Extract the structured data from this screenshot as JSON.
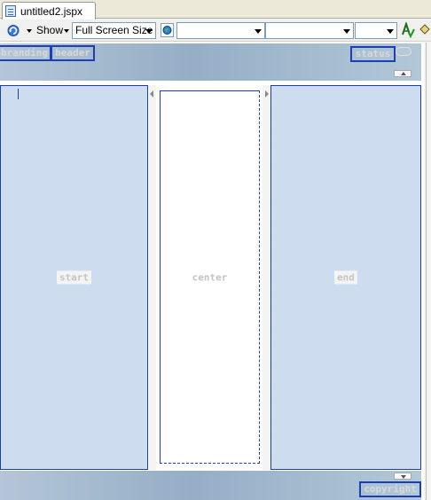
{
  "tab": {
    "title": "untitled2.jspx"
  },
  "toolbar": {
    "show_label": "Show",
    "screen_size": "Full Screen Size",
    "dropdown_1": "",
    "dropdown_2": "",
    "dropdown_3": ""
  },
  "layout": {
    "branding": "branding",
    "header": "header",
    "status": "status",
    "start": "start",
    "center": "center",
    "end": "end",
    "copyright": "copyright"
  },
  "icons": {
    "refresh": "refresh-icon",
    "globe": "globe-icon",
    "spell": "spellcheck-icon",
    "paint": "paint-icon"
  },
  "colors": {
    "panel": "#cdddef",
    "border": "#1c3fb5",
    "band": "#a4bacf"
  }
}
